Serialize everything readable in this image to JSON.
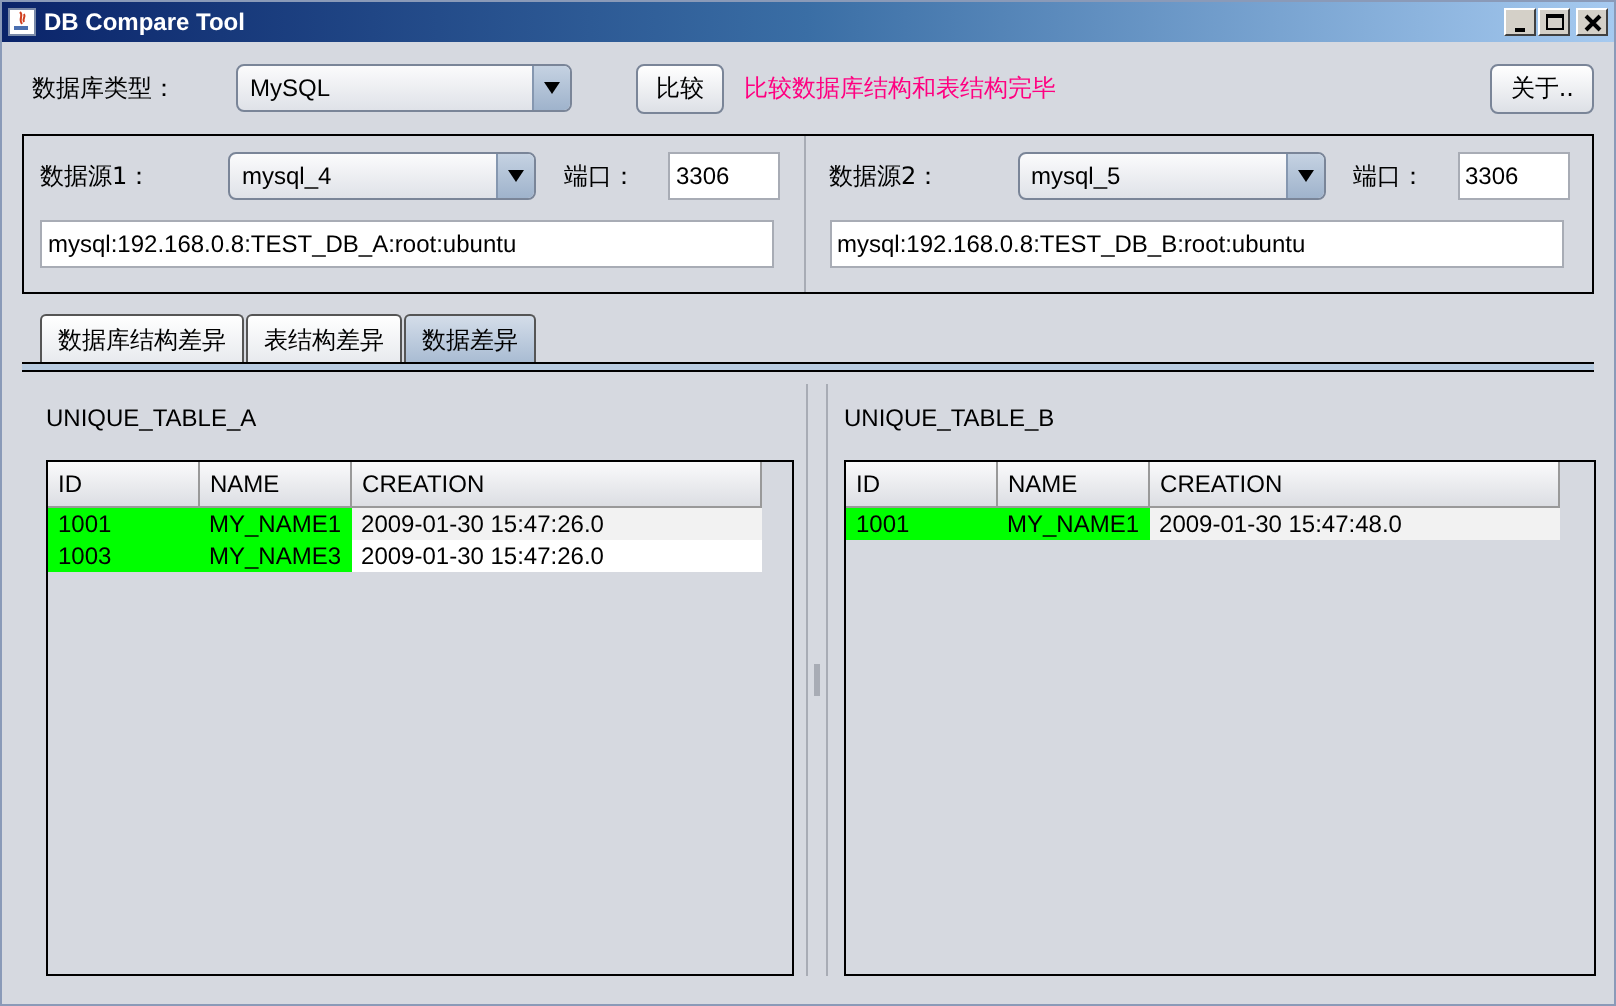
{
  "window": {
    "title": "DB Compare Tool"
  },
  "toolbar": {
    "db_type_label": "数据库类型：",
    "db_type": "MySQL",
    "compare_button": "比较",
    "status": "比较数据库结构和表结构完毕",
    "about_button": "关于.."
  },
  "sources": [
    {
      "label": "数据源1：",
      "source": "mysql_4",
      "port_label": "端口：",
      "port": "3306",
      "connection": "mysql:192.168.0.8:TEST_DB_A:root:ubuntu"
    },
    {
      "label": "数据源2：",
      "source": "mysql_5",
      "port_label": "端口：",
      "port": "3306",
      "connection": "mysql:192.168.0.8:TEST_DB_B:root:ubuntu"
    }
  ],
  "tabs": [
    {
      "label": "数据库结构差异",
      "selected": false
    },
    {
      "label": "表结构差异",
      "selected": false
    },
    {
      "label": "数据差异",
      "selected": true
    }
  ],
  "tables": [
    {
      "title": "UNIQUE_TABLE_A",
      "columns": [
        "ID",
        "NAME",
        "CREATION"
      ],
      "rows": [
        {
          "cells": [
            {
              "text": "1001",
              "highlighted": true
            },
            {
              "text": "MY_NAME1",
              "highlighted": true
            },
            {
              "text": "2009-01-30 15:47:26.0",
              "highlighted": false
            }
          ]
        },
        {
          "cells": [
            {
              "text": "1003",
              "highlighted": true
            },
            {
              "text": "MY_NAME3",
              "highlighted": true
            },
            {
              "text": "2009-01-30 15:47:26.0",
              "highlighted": false
            }
          ]
        }
      ]
    },
    {
      "title": "UNIQUE_TABLE_B",
      "columns": [
        "ID",
        "NAME",
        "CREATION"
      ],
      "rows": [
        {
          "cells": [
            {
              "text": "1001",
              "highlighted": true
            },
            {
              "text": "MY_NAME1",
              "highlighted": true
            },
            {
              "text": "2009-01-30 15:47:48.0",
              "highlighted": false
            }
          ]
        }
      ]
    }
  ]
}
